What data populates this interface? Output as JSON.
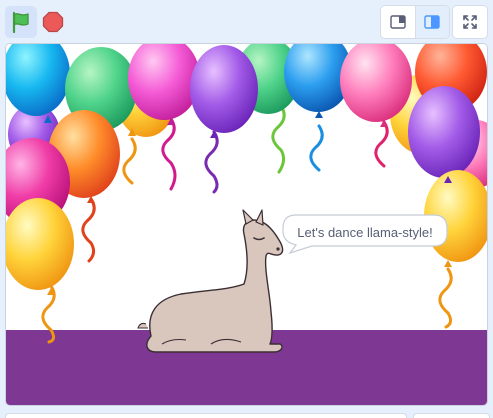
{
  "toolbar": {
    "green_flag": "green-flag-icon",
    "stop": "stop-icon",
    "small_stage": "small-stage-icon",
    "normal_stage": "normal-stage-icon",
    "fullscreen": "fullscreen-icon"
  },
  "stage": {
    "speech_bubble_text": "Let's dance llama-style!",
    "sprite": "llama",
    "backdrop": "party-balloons",
    "floor_color": "#7e3893"
  }
}
